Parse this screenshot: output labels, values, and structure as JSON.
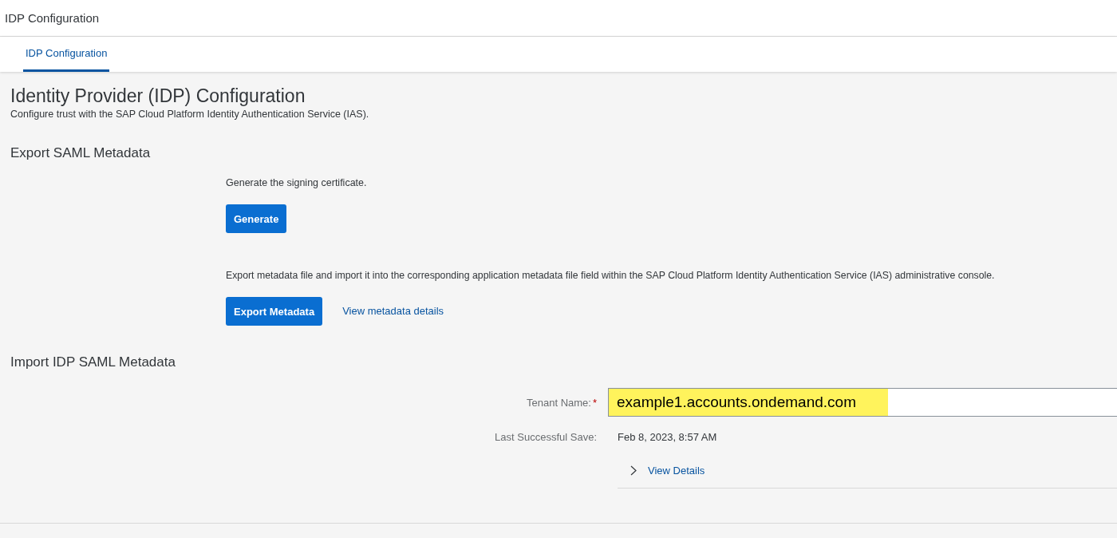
{
  "window": {
    "title": "IDP Configuration"
  },
  "tabs": [
    {
      "label": "IDP Configuration",
      "selected": true
    }
  ],
  "page": {
    "title": "Identity Provider (IDP) Configuration",
    "subtitle": "Configure trust with the SAP Cloud Platform Identity Authentication Service (IAS)."
  },
  "export_section": {
    "title": "Export SAML Metadata",
    "generate_text": "Generate the signing certificate.",
    "generate_button": "Generate",
    "export_text": "Export metadata file and import it into the corresponding application metadata file field within the SAP Cloud Platform Identity Authentication Service (IAS) administrative console.",
    "export_button": "Export Metadata",
    "details_link": "View metadata details"
  },
  "import_section": {
    "title": "Import IDP SAML Metadata",
    "tenant": {
      "label": "Tenant Name:",
      "required": true,
      "required_mark": "*",
      "value": "example1.accounts.ondemand.com",
      "highlighted": true
    },
    "last_save": {
      "label": "Last Successful Save:",
      "value": "Feb 8, 2023, 8:57 AM"
    },
    "details": {
      "label": "View Details",
      "expanded": false
    }
  }
}
